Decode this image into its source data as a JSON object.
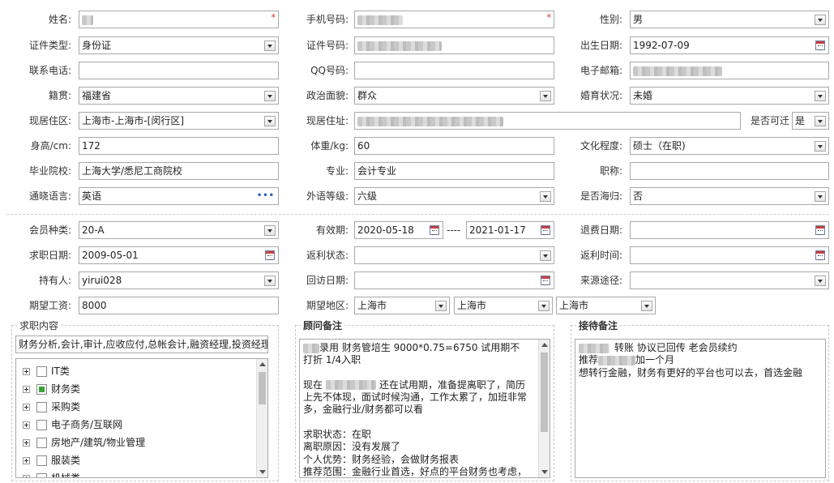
{
  "row1": {
    "name_label": "姓名:",
    "phone_label": "手机号码:",
    "gender_label": "性别:",
    "gender_value": "男"
  },
  "row2": {
    "idtype_label": "证件类型:",
    "idtype_value": "身份证",
    "idno_label": "证件号码:",
    "birth_label": "出生日期:",
    "birth_value": "1992-07-09"
  },
  "row3": {
    "contact_label": "联系电话:",
    "qq_label": "QQ号码:",
    "email_label": "电子邮箱:"
  },
  "row4": {
    "origin_label": "籍贯:",
    "origin_value": "福建省",
    "politics_label": "政治面貌:",
    "politics_value": "群众",
    "marital_label": "婚育状况:",
    "marital_value": "未婚"
  },
  "row5": {
    "region_label": "现居住区:",
    "region_value": "上海市-上海市-[闵行区]",
    "address_label": "现居住址:",
    "relocate_label": "是否可迁",
    "relocate_value": "是"
  },
  "row6": {
    "height_label": "身高/cm:",
    "height_value": "172",
    "weight_label": "体重/kg:",
    "weight_value": "60",
    "edu_label": "文化程度:",
    "edu_value": "硕士（在职)"
  },
  "row7": {
    "school_label": "毕业院校:",
    "school_value": "上海大学/悉尼工商院校",
    "major_label": "专业:",
    "major_value": "会计专业",
    "title_label": "职称:",
    "title_value": ""
  },
  "row8": {
    "lang_label": "通晓语言:",
    "lang_value": "英语",
    "langlevel_label": "外语等级:",
    "langlevel_value": "六级",
    "overseas_label": "是否海归:",
    "overseas_value": "否"
  },
  "row9": {
    "member_label": "会员种类:",
    "member_value": "20-A",
    "valid_label": "有效期:",
    "valid_from": "2020-05-18",
    "valid_sep": "----",
    "valid_to": "2021-01-17",
    "refund_label": "退费日期:",
    "refund_value": ""
  },
  "row10": {
    "jobdate_label": "求职日期:",
    "jobdate_value": "2009-05-01",
    "rebate_label": "返利状态:",
    "rebate_value": "",
    "rebatetime_label": "返利时间:",
    "rebatetime_value": ""
  },
  "row11": {
    "holder_label": "持有人:",
    "holder_value": "yirui028",
    "visit_label": "回访日期:",
    "visit_value": "",
    "source_label": "来源途径:",
    "source_value": ""
  },
  "row12": {
    "salary_label": "期望工资:",
    "salary_value": "8000",
    "area_label": "期望地区:",
    "area1": "上海市",
    "area2": "上海市",
    "area3": "上海市"
  },
  "job": {
    "title": "求职内容",
    "summary": "财务分析,会计,审计,应收应付,总帐会计,融资经理,投资经理",
    "tree": [
      {
        "label": "IT类",
        "checked": false
      },
      {
        "label": "财务类",
        "checked": true
      },
      {
        "label": "采购类",
        "checked": false
      },
      {
        "label": "电子商务/互联网",
        "checked": false
      },
      {
        "label": "房地产/建筑/物业管理",
        "checked": false
      },
      {
        "label": "服装类",
        "checked": false
      },
      {
        "label": "机械类",
        "checked": false
      }
    ]
  },
  "advisor": {
    "title": "顾问备注",
    "l1": "录用 财务管培生  9000*0.75=6750  试用期不",
    "l2": "打折  1/4入职",
    "l4a": "现在",
    "l4b": "还在试用期，准备提离职了，简历",
    "l5": "上先不体现，面试时候沟通，工作太累了，加班非常",
    "l6": "多，金融行业/财务都可以看",
    "l8": "求职状态：在职",
    "l9": "离职原因：没有发展了",
    "l10": "个人优势：财务经验，会做财务报表",
    "l11": "推荐范围：金融行业首选，好点的平台财务也考虑，"
  },
  "reception": {
    "title": "接待备注",
    "l1": "转账 协议已回传  老会员续约",
    "l2a": "推荐",
    "l2b": "加一个月",
    "l3": "想转行金融，财务有更好的平台也可以去，首选金融"
  }
}
